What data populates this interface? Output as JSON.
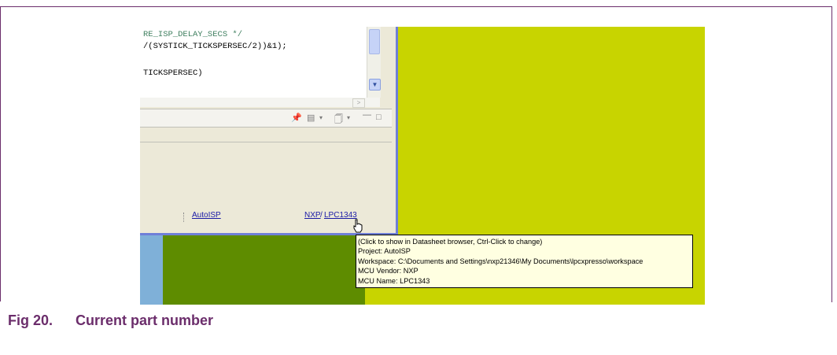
{
  "editor": {
    "code_lines": [
      "RE_ISP_DELAY_SECS */",
      "/(SYSTICK_TICKSPERSEC/2))&1);",
      "",
      "TICKSPERSEC)"
    ]
  },
  "statusbar": {
    "project_link": "AutoISP",
    "vendor_link": "NXP",
    "slash": "/",
    "mcu_link": "LPC1343"
  },
  "tooltip": {
    "lines": [
      "(Click to show in Datasheet browser, Ctrl-Click to change)",
      "Project: AutoISP",
      "Workspace: C:\\Documents and Settings\\nxp21346\\My Documents\\lpcxpresso\\workspace",
      "MCU Vendor: NXP",
      "MCU Name: LPC1343"
    ]
  },
  "caption": {
    "number": "Fig 20.",
    "title": "Current part number"
  },
  "colors": {
    "accent": "#6b2d6b",
    "background_yellow": "#c8d400",
    "background_green": "#5e8c00",
    "ide_border": "#6f7fd8",
    "tooltip_bg": "#ffffe1",
    "link": "#1a1aa6"
  },
  "icons": [
    "pin-icon",
    "monitor-icon",
    "new-view-icon",
    "dropdown-icon",
    "minimize-icon",
    "maximize-icon",
    "hand-cursor-icon",
    "scroll-down-icon",
    "scroll-right-icon"
  ]
}
